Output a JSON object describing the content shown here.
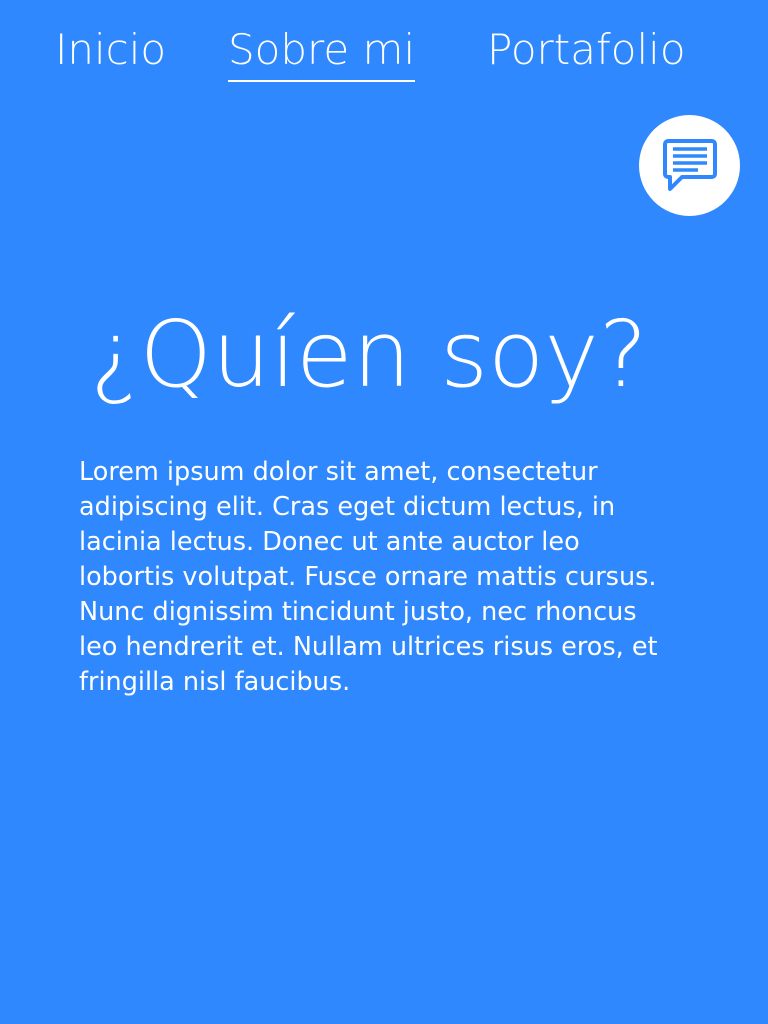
{
  "nav": {
    "items": [
      {
        "label": "Inicio",
        "active": false
      },
      {
        "label": "Sobre mi",
        "active": true
      },
      {
        "label": "Portafolio",
        "active": false
      }
    ]
  },
  "chat_button": {
    "icon": "chat-message-icon"
  },
  "main": {
    "heading": "¿Quíen soy?",
    "paragraph": "Lorem ipsum dolor sit amet, consectetur adipiscing elit. Cras eget dictum lectus, in lacinia lectus. Donec ut ante auctor leo lobortis volutpat. Fusce ornare mattis cursus. Nunc dignissim tincidunt justo, nec rhoncus leo hendrerit et. Nullam ultrices risus eros, et fringilla nisl faucibus."
  },
  "colors": {
    "background": "#2f88fd",
    "text": "#ffffff",
    "accent": "#2f88fd"
  }
}
